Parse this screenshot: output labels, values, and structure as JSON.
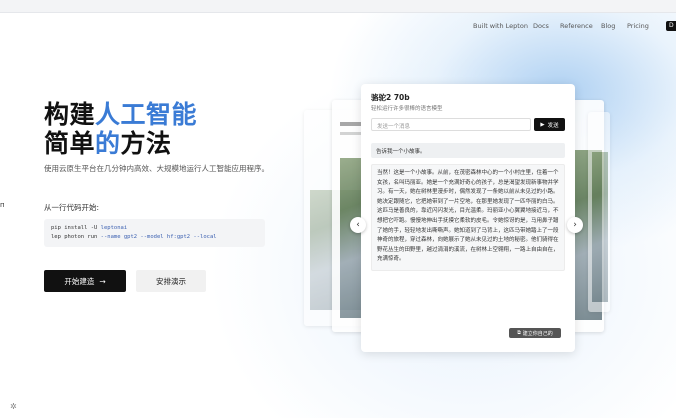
{
  "nav": {
    "links": [
      "Built with Lepton",
      "Docs",
      "Reference",
      "Blog",
      "Pricing"
    ],
    "login_label": "D"
  },
  "hero": {
    "title_line1_a": "构建",
    "title_line1_b": "人工智能",
    "title_line2_a": "简单",
    "title_line2_b": "的",
    "title_line2_c": "方法",
    "subtitle": "使用云原生平台在几分钟内高效、大规模地运行人工智能应用程序。",
    "code_label": "从一行代码开始:",
    "code_line1_cmd": "pip install -U",
    "code_line1_arg": "leptonai",
    "code_line2_cmd": "lep photon run",
    "code_line2_arg": "--name gpt2 --model hf:gpt2 --local",
    "primary_button": "开始建造",
    "secondary_button": "安排演示",
    "accent_color": "#3a7bd5"
  },
  "demo": {
    "title": "骆驼2 70b",
    "subtitle": "轻松运行许多很棒的语言模型",
    "input_placeholder": "发送一个消息",
    "send_label": "发送",
    "prompt": "告诉我一个小故事。",
    "answer": "当然！这是一个小故事。从前，在茂密森林中心的一个小村庄里，住着一个女孩，名叫玛丽亚。她是一个充满好奇心的孩子，总是渴望发现新事物并学习。有一天，她在树林里漫步时，偶然发现了一条她以前从未见过的小路。她决定跟随它，它把她带到了一片空地，在那里她发现了一匹华丽的白马。这匹马是善良的，靠近闪闪发光，目光温柔。玛丽亚小心翼翼地接近马，不想把它吓跑。慢慢地伸出手抚摸它柔软的皮毛。令她惊讶的是，马用鼻子蹭了她的手，轻轻地发出嘶嘶声。她知道到了马背上，这匹马带她踏上了一段神奇的旅程，穿过森林，向她展示了她从未见过的土地的秘密。他们骑得在野花丛生的田野里，越过涓涓的溪流，在树林上空翱翔，一路上自由自在，充满惊奇。",
    "build_label": "建立你自己的"
  },
  "icons": {
    "arrow_right": "→",
    "send": "▶",
    "chevron_left": "‹",
    "chevron_right": "›",
    "external": "⧉",
    "gear": "✲"
  }
}
